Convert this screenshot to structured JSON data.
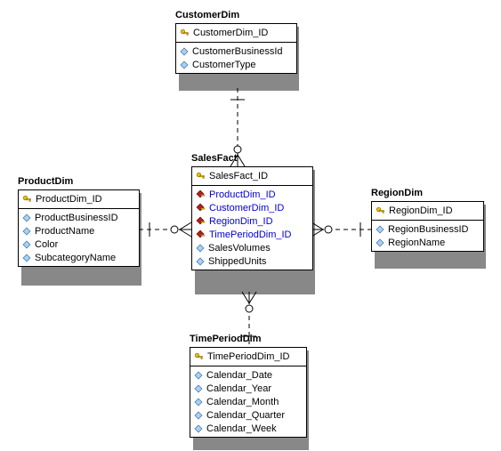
{
  "entities": {
    "customer": {
      "title": "CustomerDim",
      "pk": "CustomerDim_ID",
      "attrs": [
        "CustomerBusinessId",
        "CustomerType"
      ]
    },
    "product": {
      "title": "ProductDim",
      "pk": "ProductDim_ID",
      "attrs": [
        "ProductBusinessID",
        "ProductName",
        "Color",
        "SubcategoryName"
      ]
    },
    "sales": {
      "title": "SalesFact",
      "pk": "SalesFact_ID",
      "fks": [
        "ProductDim_ID",
        "CustomerDim_ID",
        "RegionDim_ID",
        "TimePeriodDim_ID"
      ],
      "attrs": [
        "SalesVolumes",
        "ShippedUnits"
      ]
    },
    "region": {
      "title": "RegionDim",
      "pk": "RegionDim_ID",
      "attrs": [
        "RegionBusinessID",
        "RegionName"
      ]
    },
    "time": {
      "title": "TimePeriodDim",
      "pk": "TimePeriodDim_ID",
      "attrs": [
        "Calendar_Date",
        "Calendar_Year",
        "Calendar_Month",
        "Calendar_Quarter",
        "Calendar_Week"
      ]
    }
  },
  "colors": {
    "fk": "#0000cc",
    "shadow": "#888888",
    "diamond": "#6aa8e6",
    "key": "#c0a000"
  }
}
